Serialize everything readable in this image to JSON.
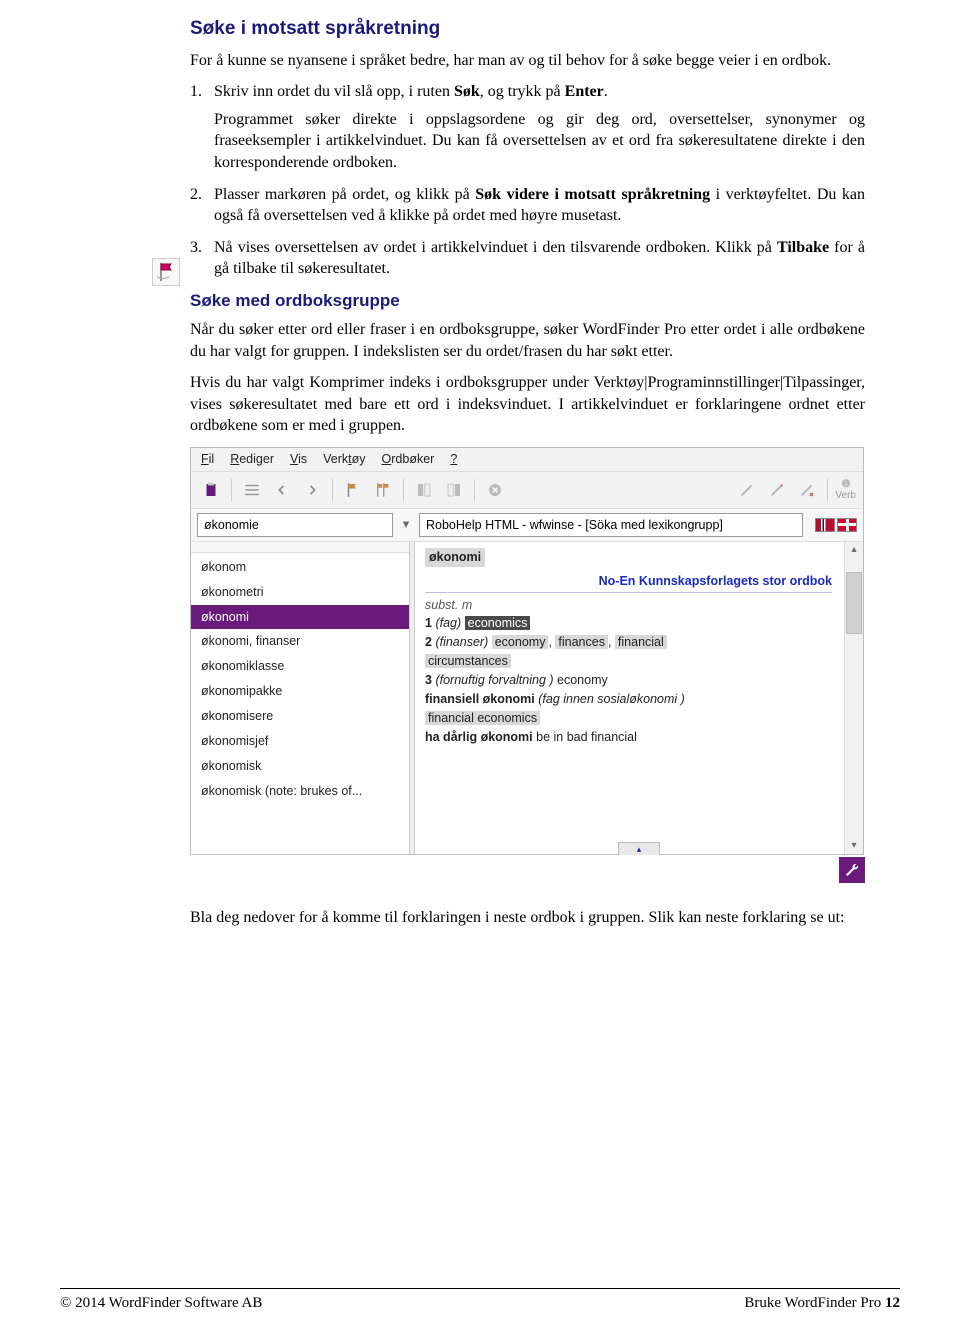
{
  "section1": {
    "title": "Søke i motsatt språkretning",
    "intro": "For å kunne se nyansene i språket bedre, har man av og til behov for å søke begge veier i en ordbok.",
    "step1_pre": "Skriv inn ordet du vil slå opp, i ruten ",
    "step1_bold": "Søk",
    "step1_post": ", og trykk på ",
    "step1_bold2": "Enter",
    "step1_end": ".",
    "step1_desc": "Programmet søker direkte i oppslagsordene og gir deg ord, oversettelser, synonymer og fraseeksempler i artikkelvinduet. Du kan få oversettelsen av et ord fra søkeresultatene direkte i den korresponderende ordboken.",
    "step2_pre": "Plasser markøren på ordet, og klikk på ",
    "step2_bold": "Søk videre i motsatt språkretning",
    "step2_post": " i verktøyfeltet. Du kan også få oversettelsen ved å klikke på ordet med høyre musetast.",
    "step3_a": "Nå vises oversettelsen av ordet i artikkelvinduet i den tilsvarende ordboken. Klikk på ",
    "step3_bold": "Tilbake",
    "step3_b": " for å gå tilbake til søkeresultatet."
  },
  "section2": {
    "title": "Søke med ordboksgruppe",
    "p1": "Når du søker etter ord eller fraser i en ordboksgruppe, søker WordFinder Pro etter ordet i alle ordbøkene du har valgt for gruppen. I indekslisten ser du ordet/frasen du har søkt etter.",
    "p2": "Hvis du har valgt Komprimer indeks i ordboksgrupper under Verktøy|Programinnstillinger|Tilpassinger, vises søkeresultatet med bare ett ord i indeksvinduet. I artikkelvinduet er forklaringene ordnet etter ordbøkene som er med i gruppen."
  },
  "app": {
    "menu": {
      "file": "Fil",
      "edit": "Rediger",
      "view": "Vis",
      "tools": "Verktøy",
      "dicts": "Ordbøker",
      "help": "?"
    },
    "menu_u": {
      "file": "F",
      "edit": "R",
      "view": "V",
      "tools": "V",
      "dicts": "O",
      "help": "?"
    },
    "search_value": "økonomie",
    "context_value": "RoboHelp HTML - wfwinse - [Söka med lexikongrupp]",
    "verb_label": "Verb",
    "index": [
      "økonom",
      "økonometri",
      "økonomi",
      "økonomi, finanser",
      "økonomiklasse",
      "økonomipakke",
      "økonomisere",
      "økonomisjef",
      "økonomisk",
      "økonomisk (note: brukes of..."
    ],
    "selected_index": 2,
    "article": {
      "headword": "økonomi",
      "dict_title": "No-En Kunnskapsforlagets stor ordbok",
      "pos": "subst. m",
      "s1": {
        "n": "1",
        "dom": "(fag)",
        "trans_hl": "economics"
      },
      "s2": {
        "n": "2",
        "dom": "(finanser)",
        "t1": "economy",
        "t2": "finances",
        "t3": "financial",
        "t3b": "circumstances"
      },
      "s3": {
        "n": "3",
        "dom": "(fornuftig forvaltning )",
        "t1": "economy"
      },
      "ph1": {
        "bold": "finansiell økonomi",
        "paren": "(fag innen sosialøkonomi )"
      },
      "ph1t": "financial economics",
      "ph2": {
        "bold": "ha dårlig økonomi",
        "trans": "be in bad financial"
      }
    }
  },
  "after_fig": "Bla deg nedover for å komme til forklaringen i neste ordbok i gruppen. Slik kan neste forklaring se ut:",
  "footer": {
    "left": "© 2014 WordFinder Software AB",
    "right_text": "Bruke WordFinder Pro ",
    "right_page": "12"
  }
}
